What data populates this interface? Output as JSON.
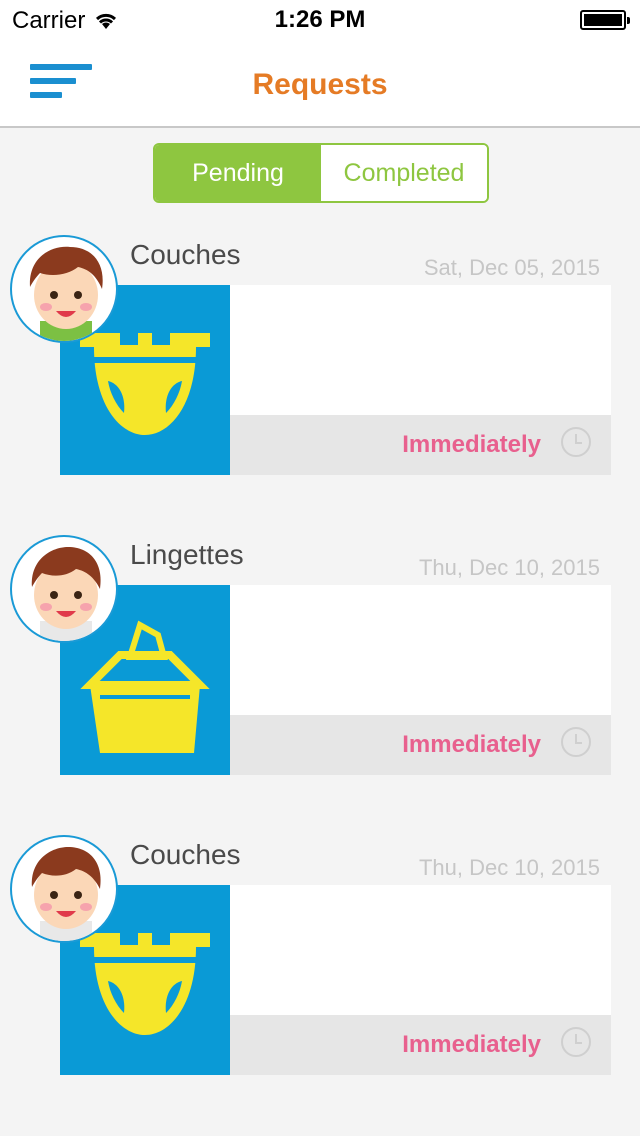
{
  "status_bar": {
    "carrier": "Carrier",
    "time": "1:26 PM"
  },
  "nav": {
    "title": "Requests",
    "menu_icon": "menu-lines-icon"
  },
  "tabs": [
    {
      "label": "Pending",
      "active": true
    },
    {
      "label": "Completed",
      "active": false
    }
  ],
  "requests": [
    {
      "title": "Couches",
      "date": "Sat, Dec 05, 2015",
      "urgency": "Immediately",
      "icon": "diaper-icon"
    },
    {
      "title": "Lingettes",
      "date": "Thu, Dec 10, 2015",
      "urgency": "Immediately",
      "icon": "wipes-box-icon"
    },
    {
      "title": "Couches",
      "date": "Thu, Dec 10, 2015",
      "urgency": "Immediately",
      "icon": "diaper-icon"
    }
  ],
  "colors": {
    "accent_orange": "#e57b25",
    "accent_green": "#8ec640",
    "thumb_blue": "#0a9ad6",
    "urgency_pink": "#e8608e",
    "menu_blue": "#1a8fd0"
  }
}
